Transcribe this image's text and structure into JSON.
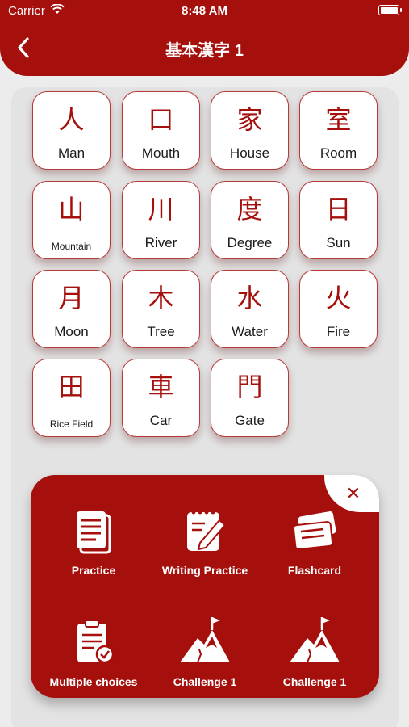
{
  "status_bar": {
    "carrier": "Carrier",
    "time": "8:48 AM"
  },
  "header": {
    "title": "基本漢字 1"
  },
  "kanji_cards": [
    {
      "kanji": "人",
      "meaning": "Man"
    },
    {
      "kanji": "口",
      "meaning": "Mouth"
    },
    {
      "kanji": "家",
      "meaning": "House"
    },
    {
      "kanji": "室",
      "meaning": "Room"
    },
    {
      "kanji": "山",
      "meaning": "Mountain"
    },
    {
      "kanji": "川",
      "meaning": "River"
    },
    {
      "kanji": "度",
      "meaning": "Degree"
    },
    {
      "kanji": "日",
      "meaning": "Sun"
    },
    {
      "kanji": "月",
      "meaning": "Moon"
    },
    {
      "kanji": "木",
      "meaning": "Tree"
    },
    {
      "kanji": "水",
      "meaning": "Water"
    },
    {
      "kanji": "火",
      "meaning": "Fire"
    },
    {
      "kanji": "田",
      "meaning": "Rice Field"
    },
    {
      "kanji": "車",
      "meaning": "Car"
    },
    {
      "kanji": "門",
      "meaning": "Gate"
    }
  ],
  "menu": {
    "options": [
      {
        "label": "Practice",
        "icon": "documents-icon"
      },
      {
        "label": "Writing Practice",
        "icon": "notepad-pencil-icon"
      },
      {
        "label": "Flashcard",
        "icon": "flashcards-icon"
      },
      {
        "label": "Multiple choices",
        "icon": "clipboard-check-icon"
      },
      {
        "label": "Challenge 1",
        "icon": "mountain-flag-icon"
      },
      {
        "label": "Challenge 1",
        "icon": "mountain-flag-icon"
      }
    ]
  },
  "colors": {
    "accent": "#a50f0c",
    "background": "#ececec",
    "card": "#ffffff"
  }
}
